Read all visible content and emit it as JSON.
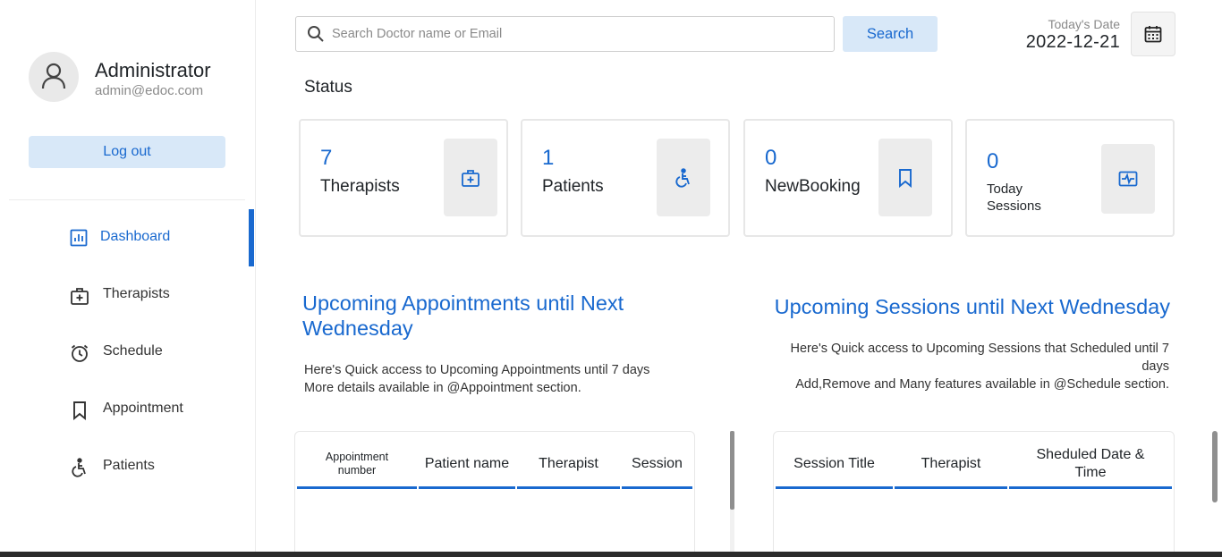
{
  "profile": {
    "name": "Administrator",
    "email": "admin@edoc.com",
    "logout_label": "Log out"
  },
  "nav": {
    "items": [
      {
        "label": "Dashboard",
        "icon": "dashboard-icon",
        "active": true
      },
      {
        "label": "Therapists",
        "icon": "medical-bag-icon",
        "active": false
      },
      {
        "label": "Schedule",
        "icon": "alarm-clock-icon",
        "active": false
      },
      {
        "label": "Appointment",
        "icon": "bookmark-icon",
        "active": false
      },
      {
        "label": "Patients",
        "icon": "wheelchair-icon",
        "active": false
      }
    ]
  },
  "search": {
    "placeholder": "Search Doctor name or Email",
    "value": "",
    "button_label": "Search"
  },
  "date": {
    "label": "Today's Date",
    "value": "2022-12-21"
  },
  "status": {
    "title": "Status",
    "cards": [
      {
        "count": "7",
        "label": "Therapists",
        "icon": "medical-bag-icon"
      },
      {
        "count": "1",
        "label": "Patients",
        "icon": "wheelchair-icon"
      },
      {
        "count": "0",
        "label": "NewBooking",
        "icon": "bookmark-icon"
      },
      {
        "count": "0",
        "label_line1": "Today",
        "label_line2": "Sessions",
        "icon": "session-pulse-icon"
      }
    ]
  },
  "appointments": {
    "title_line1": "Upcoming Appointments until Next",
    "title_line2": "Wednesday",
    "desc_line1": "Here's Quick access to Upcoming Appointments until 7 days",
    "desc_line2": "More details available in @Appointment section.",
    "columns": [
      "Appointment number",
      "Patient name",
      "Therapist",
      "Session"
    ]
  },
  "sessions": {
    "title": "Upcoming Sessions until Next Wednesday",
    "desc_line1": "Here's Quick access to Upcoming Sessions that Scheduled until 7",
    "desc_line2": "days",
    "desc_line3": "Add,Remove and Many features available in @Schedule section.",
    "columns": [
      "Session Title",
      "Therapist",
      "Sheduled Date & Time"
    ]
  },
  "colors": {
    "accent": "#1969cf",
    "accent_light": "#d8e8f8",
    "card_border": "#e7e7e7",
    "icon_bg": "#ececec"
  }
}
